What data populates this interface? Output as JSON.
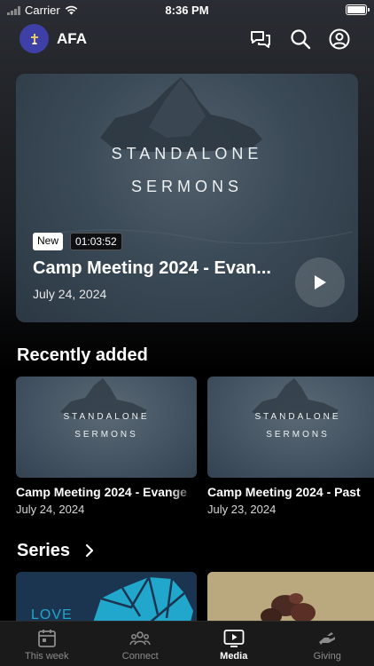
{
  "status_bar": {
    "carrier": "Carrier",
    "time": "8:36 PM"
  },
  "header": {
    "app_name": "AFA"
  },
  "hero": {
    "artwork_line1": "STANDALONE",
    "artwork_line2": "SERMONS",
    "tag": "New",
    "duration": "01:03:52",
    "title": "Camp Meeting 2024 - Evan...",
    "date": "July 24, 2024"
  },
  "recently_added": {
    "title": "Recently added",
    "items": [
      {
        "artwork_line1": "STANDALONE",
        "artwork_line2": "SERMONS",
        "title": "Camp Meeting 2024 - Evange",
        "date": "July 24, 2024"
      },
      {
        "artwork_line1": "STANDALONE",
        "artwork_line2": "SERMONS",
        "title": "Camp Meeting 2024 - Past",
        "date": "July 23, 2024"
      }
    ]
  },
  "series": {
    "title": "Series",
    "items": [
      {
        "artwork_text": "LOVE"
      },
      {
        "artwork_text": ""
      }
    ]
  },
  "tab_bar": {
    "items": [
      {
        "label": "This week",
        "icon": "calendar-icon",
        "active": false
      },
      {
        "label": "Connect",
        "icon": "people-icon",
        "active": false
      },
      {
        "label": "Media",
        "icon": "play-screen-icon",
        "active": true
      },
      {
        "label": "Giving",
        "icon": "giving-hand-icon",
        "active": false
      }
    ]
  },
  "colors": {
    "logo_bg": "#3f3fa8",
    "active_tab": "#ffffff",
    "inactive_tab": "#8c8c8c"
  }
}
